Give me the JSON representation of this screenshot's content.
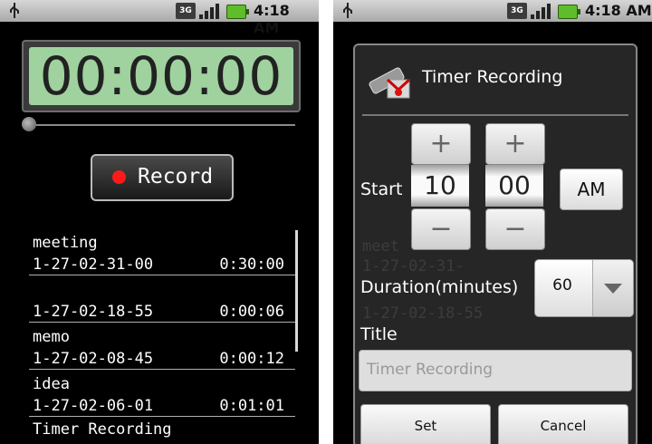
{
  "status_bar": {
    "left_time": "4:18 AM",
    "right_time": "4:18 AM",
    "network_type": "3G",
    "battery_color": "#5ebd2a"
  },
  "recorder": {
    "timer_display": "00:00:00",
    "record_label": "Record",
    "recordings": [
      {
        "name": "meeting",
        "date": "1-27-02-31-00",
        "duration": "0:30:00"
      },
      {
        "name": "",
        "date": "1-27-02-18-55",
        "duration": "0:00:06"
      },
      {
        "name": "memo",
        "date": "1-27-02-08-45",
        "duration": "0:00:12"
      },
      {
        "name": "idea",
        "date": "1-27-02-06-01",
        "duration": "0:01:01"
      },
      {
        "name": "Timer Recording",
        "date": "",
        "duration": ""
      }
    ]
  },
  "dialog": {
    "title": "Timer Recording",
    "start_label": "Start",
    "hour": "10",
    "minute": "00",
    "plus": "+",
    "minus": "−",
    "ampm": "AM",
    "duration_label": "Duration(minutes)",
    "duration_value": "60",
    "title_label": "Title",
    "title_value": "Timer Recording",
    "set_label": "Set",
    "cancel_label": "Cancel",
    "bg_ghost": [
      "meet",
      "1-27-02-31-",
      "1-27-02-18-55"
    ]
  }
}
